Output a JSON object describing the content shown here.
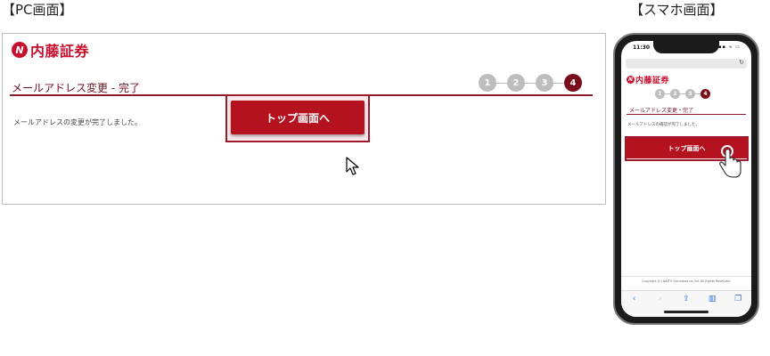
{
  "labels": {
    "pc": "【PC画面】",
    "sp": "【スマホ画面】"
  },
  "brand": {
    "mark": "N",
    "name": "内藤証券",
    "color": "#c8102e"
  },
  "page": {
    "title": "メールアドレス変更 - 完了",
    "steps": [
      "1",
      "2",
      "3",
      "4"
    ],
    "active_step": 4,
    "pc_message": "メールアドレスの変更が完了しました。",
    "top_button": "トップ画面へ"
  },
  "smartphone": {
    "time": "11:30",
    "status_icons": "▪▪ ≈ ▭",
    "refresh_icon": "↻",
    "title": "メールアドレス変更・完了",
    "message": "メールアドレスの確認が完了しました。",
    "top_button": "トップ画面へ",
    "copyright": "Copyright (C) NAITO Securities co.,ltd. All Rights Reserved.",
    "toolbar": {
      "back": "‹",
      "forward": "›",
      "share": "⇧",
      "bookmarks": "▥",
      "tabs": "❐"
    }
  },
  "colors": {
    "accent": "#b5121f",
    "dark_red": "#7a0d1c",
    "step_inactive": "#bdbdbd"
  }
}
